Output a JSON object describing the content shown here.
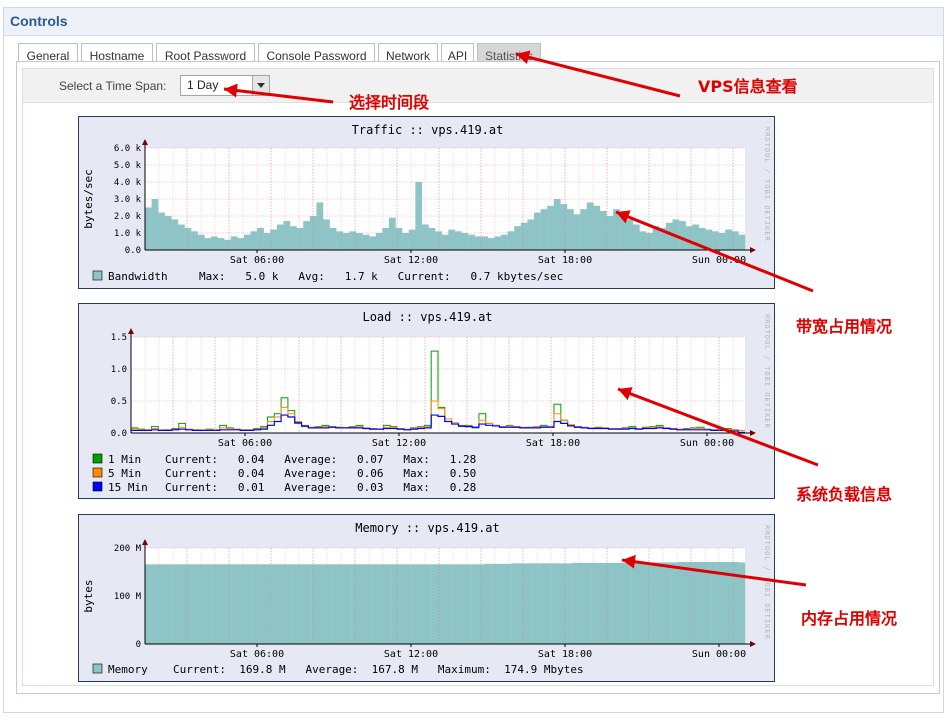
{
  "header": {
    "title": "Controls"
  },
  "tabs": [
    {
      "label": "General",
      "active": false
    },
    {
      "label": "Hostname",
      "active": false
    },
    {
      "label": "Root Password",
      "active": false
    },
    {
      "label": "Console Password",
      "active": false
    },
    {
      "label": "Network",
      "active": false
    },
    {
      "label": "API",
      "active": false
    },
    {
      "label": "Statistics",
      "active": true
    }
  ],
  "timespan": {
    "label": "Select a Time Span:",
    "value": "1 Day"
  },
  "side_text": "RRDTOOL / TOBI OETIKER",
  "x_ticks": [
    "Sat 06:00",
    "Sat 12:00",
    "Sat 18:00",
    "Sun 00:00"
  ],
  "annotations": {
    "vps_info": "VPS信息查看",
    "time_range": "选择时间段",
    "bandwidth": "带宽占用情况",
    "load": "系统负载信息",
    "memory": "内存占用情况"
  },
  "colors": {
    "traffic_fill": "#8fc4c6",
    "min1": "#00a000",
    "min5": "#ff8c00",
    "min15": "#0000ff",
    "annotation": "#e00000",
    "graph_bg": "#e6e9f3"
  },
  "chart_data": [
    {
      "type": "area",
      "title": "Traffic :: vps.419.at",
      "ylabel": "bytes/sec",
      "y_ticks": [
        "6.0 k",
        "5.0 k",
        "4.0 k",
        "3.0 k",
        "2.0 k",
        "1.0 k",
        "0.0"
      ],
      "ylim": [
        0,
        6000
      ],
      "x_ticks": [
        "Sat 06:00",
        "Sat 12:00",
        "Sat 18:00",
        "Sun 00:00"
      ],
      "series": [
        {
          "name": "Bandwidth",
          "unit": "bytes/sec",
          "values": [
            2500,
            3000,
            2200,
            2000,
            1800,
            1500,
            1300,
            1100,
            900,
            700,
            800,
            700,
            600,
            800,
            700,
            900,
            1100,
            1300,
            1000,
            1200,
            1500,
            1700,
            1400,
            1300,
            1700,
            2000,
            2800,
            1800,
            1300,
            1100,
            1000,
            1100,
            1000,
            900,
            800,
            1000,
            1300,
            1900,
            1300,
            1000,
            1200,
            4000,
            1500,
            1300,
            1100,
            900,
            1200,
            1100,
            1000,
            900,
            800,
            800,
            700,
            800,
            900,
            1100,
            1400,
            1600,
            1800,
            2200,
            2400,
            2600,
            3000,
            2700,
            2400,
            2100,
            2400,
            2800,
            2600,
            2300,
            2000,
            2400,
            2200,
            1800,
            1500,
            1100,
            1000,
            1400,
            1300,
            1600,
            1800,
            1700,
            1400,
            1500,
            1300,
            1200,
            1100,
            1000,
            1200,
            1100,
            900
          ]
        }
      ],
      "legend": [
        {
          "label": "Bandwidth",
          "text": "Max:   5.0 k   Avg:   1.7 k   Current:   0.7 kbytes/sec"
        }
      ]
    },
    {
      "type": "line",
      "title": "Load :: vps.419.at",
      "y_ticks": [
        "1.5",
        "1.0",
        "0.5",
        "0.0"
      ],
      "ylim": [
        0,
        1.5
      ],
      "x_ticks": [
        "Sat 06:00",
        "Sat 12:00",
        "Sat 18:00",
        "Sun 00:00"
      ],
      "series": [
        {
          "name": "1 Min",
          "values": [
            0.08,
            0.06,
            0.05,
            0.1,
            0.04,
            0.05,
            0.07,
            0.15,
            0.05,
            0.05,
            0.04,
            0.06,
            0.05,
            0.12,
            0.08,
            0.06,
            0.05,
            0.05,
            0.07,
            0.1,
            0.25,
            0.3,
            0.55,
            0.35,
            0.15,
            0.1,
            0.08,
            0.1,
            0.12,
            0.1,
            0.09,
            0.08,
            0.1,
            0.12,
            0.07,
            0.06,
            0.06,
            0.12,
            0.1,
            0.06,
            0.05,
            0.08,
            0.1,
            0.12,
            1.28,
            0.4,
            0.18,
            0.14,
            0.1,
            0.12,
            0.08,
            0.3,
            0.15,
            0.12,
            0.1,
            0.12,
            0.1,
            0.08,
            0.09,
            0.1,
            0.12,
            0.1,
            0.45,
            0.2,
            0.12,
            0.1,
            0.08,
            0.07,
            0.09,
            0.08,
            0.07,
            0.06,
            0.08,
            0.1,
            0.07,
            0.09,
            0.1,
            0.12,
            0.08,
            0.06,
            0.05,
            0.07,
            0.08,
            0.09,
            0.06,
            0.05,
            0.06,
            0.07,
            0.05,
            0.04
          ]
        },
        {
          "name": "5 Min",
          "values": [
            0.06,
            0.05,
            0.05,
            0.07,
            0.05,
            0.05,
            0.06,
            0.09,
            0.06,
            0.05,
            0.05,
            0.05,
            0.05,
            0.08,
            0.07,
            0.06,
            0.05,
            0.05,
            0.06,
            0.08,
            0.18,
            0.25,
            0.4,
            0.3,
            0.18,
            0.12,
            0.09,
            0.09,
            0.1,
            0.1,
            0.09,
            0.08,
            0.09,
            0.1,
            0.08,
            0.07,
            0.06,
            0.09,
            0.09,
            0.07,
            0.06,
            0.07,
            0.09,
            0.1,
            0.5,
            0.38,
            0.22,
            0.16,
            0.12,
            0.11,
            0.09,
            0.2,
            0.15,
            0.12,
            0.1,
            0.11,
            0.1,
            0.09,
            0.09,
            0.1,
            0.1,
            0.1,
            0.3,
            0.2,
            0.13,
            0.1,
            0.09,
            0.08,
            0.08,
            0.08,
            0.07,
            0.07,
            0.07,
            0.08,
            0.07,
            0.08,
            0.09,
            0.1,
            0.08,
            0.07,
            0.06,
            0.06,
            0.07,
            0.07,
            0.06,
            0.05,
            0.05,
            0.06,
            0.05,
            0.04
          ]
        },
        {
          "name": "15 Min",
          "values": [
            0.04,
            0.04,
            0.04,
            0.05,
            0.04,
            0.04,
            0.05,
            0.06,
            0.05,
            0.04,
            0.04,
            0.04,
            0.04,
            0.05,
            0.05,
            0.05,
            0.04,
            0.04,
            0.05,
            0.06,
            0.12,
            0.18,
            0.28,
            0.25,
            0.16,
            0.11,
            0.08,
            0.08,
            0.08,
            0.09,
            0.08,
            0.08,
            0.08,
            0.08,
            0.07,
            0.06,
            0.06,
            0.07,
            0.07,
            0.06,
            0.05,
            0.06,
            0.07,
            0.08,
            0.28,
            0.26,
            0.18,
            0.14,
            0.11,
            0.1,
            0.09,
            0.14,
            0.12,
            0.11,
            0.09,
            0.09,
            0.09,
            0.08,
            0.08,
            0.08,
            0.09,
            0.09,
            0.18,
            0.15,
            0.11,
            0.09,
            0.08,
            0.07,
            0.07,
            0.07,
            0.06,
            0.06,
            0.06,
            0.07,
            0.06,
            0.07,
            0.07,
            0.08,
            0.07,
            0.06,
            0.05,
            0.05,
            0.05,
            0.05,
            0.05,
            0.04,
            0.04,
            0.04,
            0.03,
            0.01
          ]
        }
      ],
      "legend": [
        {
          "label": "1 Min",
          "text": "Current:   0.04   Average:   0.07   Max:   1.28"
        },
        {
          "label": "5 Min",
          "text": "Current:   0.04   Average:   0.06   Max:   0.50"
        },
        {
          "label": "15 Min",
          "text": "Current:   0.01   Average:   0.03   Max:   0.28"
        }
      ]
    },
    {
      "type": "area",
      "title": "Memory :: vps.419.at",
      "ylabel": "bytes",
      "y_ticks": [
        "200 M",
        "100 M",
        "0"
      ],
      "ylim": [
        0,
        200
      ],
      "x_ticks": [
        "Sat 06:00",
        "Sat 12:00",
        "Sat 18:00",
        "Sun 00:00"
      ],
      "series": [
        {
          "name": "Memory",
          "unit": "Mbytes",
          "values": [
            166,
            166,
            166,
            166,
            166,
            166,
            166,
            166,
            166,
            166,
            166,
            166,
            166,
            166,
            166,
            166,
            166,
            166,
            166,
            166,
            166,
            166,
            166,
            166,
            166,
            166,
            166,
            166,
            166,
            166,
            166,
            166,
            166,
            166,
            166,
            166,
            166,
            166,
            166,
            166,
            166,
            166,
            166,
            166,
            166,
            166,
            166,
            166,
            166,
            166,
            166,
            167,
            167,
            167,
            167,
            168,
            168,
            168,
            168,
            168,
            168,
            168,
            168,
            168,
            169,
            169,
            169,
            169,
            169,
            169,
            169,
            169,
            170,
            170,
            170,
            170,
            170,
            170,
            170,
            170,
            171,
            171,
            171,
            171,
            171,
            171,
            171,
            171,
            171,
            170
          ]
        }
      ],
      "legend": [
        {
          "label": "Memory",
          "text": "Current:  169.8 M   Average:  167.8 M   Maximum:  174.9 Mbytes"
        }
      ]
    }
  ]
}
